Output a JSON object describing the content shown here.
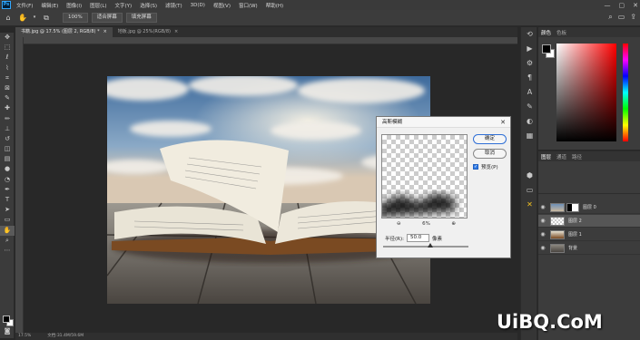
{
  "app": {
    "logo": "Ps"
  },
  "menu": [
    "文件(F)",
    "编辑(E)",
    "图像(I)",
    "图层(L)",
    "文字(Y)",
    "选择(S)",
    "滤镜(T)",
    "3D(D)",
    "视图(V)",
    "窗口(W)",
    "帮助(H)"
  ],
  "window_controls": {
    "minimize": "—",
    "maximize": "▢",
    "close": "✕"
  },
  "options": {
    "zoom": "100%",
    "fit_screen": "适合屏幕",
    "fill_screen": "填充屏幕"
  },
  "tabs": [
    {
      "label": "书籍.jpg @ 17.5% (图层 2, RGB/8) *",
      "close": "×"
    },
    {
      "label": "地板.jpg @ 25%(RGB/8)",
      "close": "×"
    }
  ],
  "status": {
    "zoom": "17.5%",
    "doc": "文档:31.4M/59.6M"
  },
  "dialog": {
    "title": "高斯模糊",
    "close": "✕",
    "ok": "确定",
    "cancel": "取消",
    "preview_label": "预览(P)",
    "preview_checked": true,
    "zoom_out": "⊖",
    "zoom_value": "6%",
    "zoom_in": "⊕",
    "radius_label": "半径(R):",
    "radius_value": "50.0",
    "radius_unit": "像素",
    "radius_slider_fraction": 0.55
  },
  "color_panel": {
    "tabs": [
      "颜色",
      "色板"
    ]
  },
  "layers_panel": {
    "tabs": [
      "图层",
      "通道",
      "路径"
    ],
    "layers": [
      {
        "name": "图层 0",
        "visible": true,
        "selected": false,
        "has_mask": true
      },
      {
        "name": "图层 2",
        "visible": true,
        "selected": true,
        "has_mask": false
      },
      {
        "name": "图层 1",
        "visible": true,
        "selected": false,
        "has_mask": false
      },
      {
        "name": "背景",
        "visible": true,
        "selected": false,
        "has_mask": false
      }
    ]
  },
  "watermark": "UiBQ.CoM",
  "colors": {
    "accent": "#31a8ff",
    "panel_bg": "#3c3c3c",
    "canvas_bg": "#282828"
  }
}
